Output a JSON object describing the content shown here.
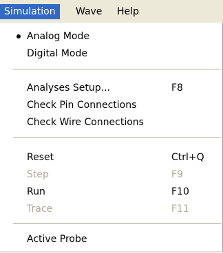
{
  "menubar": {
    "items": [
      {
        "label": "Simulation"
      },
      {
        "label": "Wave"
      },
      {
        "label": "Help"
      }
    ]
  },
  "menu": {
    "items": [
      {
        "label": "Analog Mode",
        "shortcut": "",
        "checked": true,
        "enabled": true
      },
      {
        "label": "Digital Mode",
        "shortcut": "",
        "checked": false,
        "enabled": true
      },
      {
        "label": "Analyses Setup...",
        "shortcut": "F8",
        "enabled": true
      },
      {
        "label": "Check Pin Connections",
        "shortcut": "",
        "enabled": true
      },
      {
        "label": "Check Wire Connections",
        "shortcut": "",
        "enabled": true
      },
      {
        "label": "Reset",
        "shortcut": "Ctrl+Q",
        "enabled": true
      },
      {
        "label": "Step",
        "shortcut": "F9",
        "enabled": false
      },
      {
        "label": "Run",
        "shortcut": "F10",
        "enabled": true
      },
      {
        "label": "Trace",
        "shortcut": "F11",
        "enabled": false
      },
      {
        "label": "Active Probe",
        "shortcut": "",
        "enabled": true
      }
    ]
  },
  "colors": {
    "highlight": "#316ac5",
    "menubar_bg": "#ece9d8",
    "disabled_text": "#aca899"
  }
}
